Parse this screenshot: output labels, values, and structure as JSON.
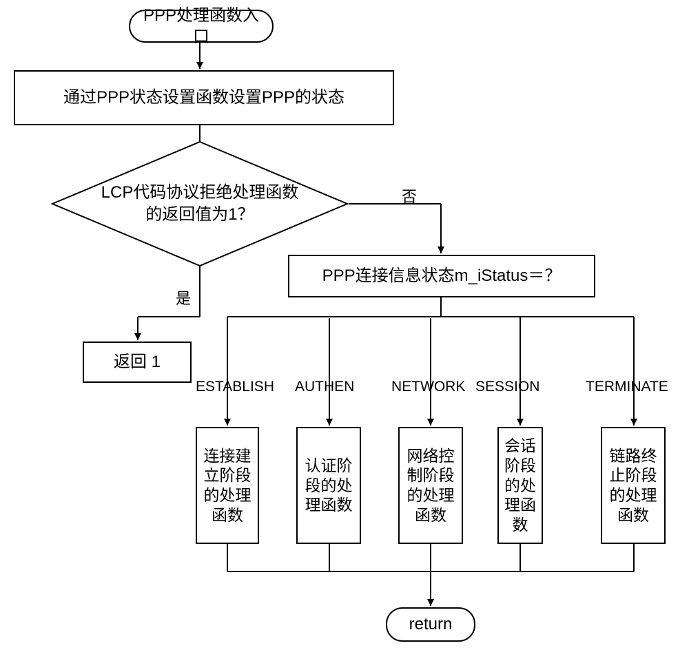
{
  "entry": "PPP处理函数入口",
  "step1": "通过PPP状态设置函数设置PPP的状态",
  "decision1": "LCP代码协议拒绝处理函数\n的返回值为1？",
  "yes": "是",
  "no": "否",
  "return1": "返回 1",
  "decision2": "PPP连接信息状态m_iStatus＝？",
  "branch1_label": "ESTABLISH",
  "branch2_label": "AUTHEN",
  "branch3_label": "NETWORK",
  "branch4_label": "SESSION",
  "branch5_label": "TERMINATE",
  "branch1_box": "连接建\n立阶段\n的处理\n函数",
  "branch2_box": "认证阶\n段的处\n理函数",
  "branch3_box": "网络控\n制阶段\n的处理\n函数",
  "branch4_box": "会话\n阶段\n的处\n理函\n数",
  "branch5_box": "链路终\n止阶段\n的处理\n函数",
  "return2": "return"
}
